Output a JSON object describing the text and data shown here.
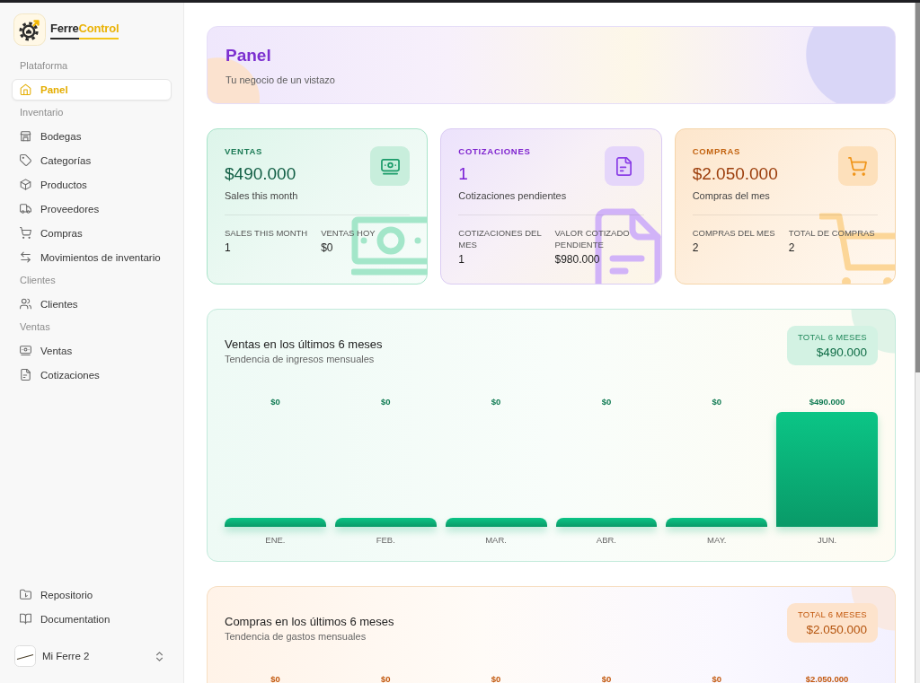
{
  "sidebar": {
    "brand": {
      "name_start": "Ferre",
      "name_end": "Control"
    },
    "groups": [
      {
        "label": "Plataforma",
        "items": [
          {
            "label": "Panel",
            "selected": true
          }
        ]
      },
      {
        "label": "Inventario",
        "items": [
          {
            "label": "Bodegas",
            "selected": false
          },
          {
            "label": "Categorías",
            "selected": false
          },
          {
            "label": "Productos",
            "selected": false
          },
          {
            "label": "Proveedores",
            "selected": false
          },
          {
            "label": "Compras",
            "selected": false
          },
          {
            "label": "Movimientos de inventario",
            "selected": false
          }
        ]
      },
      {
        "label": "Clientes",
        "items": [
          {
            "label": "Clientes",
            "selected": false
          }
        ]
      },
      {
        "label": "Ventas",
        "items": [
          {
            "label": "Ventas",
            "selected": false
          },
          {
            "label": "Cotizaciones",
            "selected": false
          }
        ]
      }
    ],
    "footer_links": [
      {
        "label": "Repositorio"
      },
      {
        "label": "Documentation"
      }
    ],
    "team": {
      "name": "Mi Ferre 2"
    }
  },
  "header": {
    "title": "Panel",
    "subtitle": "Tu negocio de un vistazo"
  },
  "stat_cards": [
    {
      "kind": "sales",
      "label": "VENTAS",
      "value": "$490.000",
      "caption": "Sales this month",
      "stats": [
        {
          "label": "SALES THIS MONTH",
          "value": "1"
        },
        {
          "label": "VENTAS HOY",
          "value": "$0"
        }
      ]
    },
    {
      "kind": "quotes",
      "label": "COTIZACIONES",
      "value": "1",
      "caption": "Cotizaciones pendientes",
      "stats": [
        {
          "label": "COTIZACIONES DEL MES",
          "value": "1"
        },
        {
          "label": "VALOR COTIZADO PENDIENTE",
          "value": "$980.000"
        }
      ]
    },
    {
      "kind": "purchases",
      "label": "COMPRAS",
      "value": "$2.050.000",
      "caption": "Compras del mes",
      "stats": [
        {
          "label": "COMPRAS DEL MES",
          "value": "2"
        },
        {
          "label": "TOTAL DE COMPRAS",
          "value": "2"
        }
      ]
    }
  ],
  "chart_cards": [
    {
      "kind": "sales",
      "title": "Ventas en los últimos 6 meses",
      "subtitle": "Tendencia de ingresos mensuales",
      "total_label": "TOTAL 6 MESES",
      "total_value": "$490.000",
      "columns": [
        {
          "value": "$0",
          "kind": "empty",
          "month": "ENE."
        },
        {
          "value": "$0",
          "kind": "empty",
          "month": "FEB."
        },
        {
          "value": "$0",
          "kind": "empty",
          "month": "MAR."
        },
        {
          "value": "$0",
          "kind": "empty",
          "month": "ABR."
        },
        {
          "value": "$0",
          "kind": "empty",
          "month": "MAY."
        },
        {
          "value": "$490.000",
          "kind": "full",
          "month": "JUN."
        }
      ]
    },
    {
      "kind": "purchases",
      "title": "Compras en los últimos 6 meses",
      "subtitle": "Tendencia de gastos mensuales",
      "total_label": "TOTAL 6 MESES",
      "total_value": "$2.050.000",
      "columns": [
        {
          "value": "$0"
        },
        {
          "value": "$0"
        },
        {
          "value": "$0"
        },
        {
          "value": "$0"
        },
        {
          "value": "$0"
        },
        {
          "value": "$2.050.000"
        }
      ]
    }
  ]
}
